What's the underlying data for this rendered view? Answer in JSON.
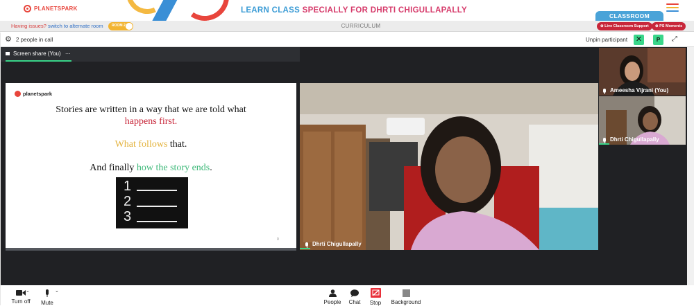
{
  "header": {
    "logo": "PLANETSPARK",
    "tagline_a": "LEARN CLASS",
    "tagline_b": "SPECIALLY FOR DHRTI CHIGULLAPALLY",
    "classroom_tab": "CLASSROOM",
    "menu_colors": [
      "#e8453c",
      "#f2b431",
      "#3a8fd6"
    ]
  },
  "issuebar": {
    "issue_text": "Having issues?",
    "issue_link": "switch to alternate room",
    "room_toggle_label": "ROOM 2",
    "curriculum": "CURRICULUM",
    "support_button": "Live Classroom Support",
    "moments_button": "PS Moments"
  },
  "meet": {
    "people_count": "2 people in call",
    "unpin_label": "Unpin participant",
    "pinned_initial": "P",
    "share_tab": "Screen share (You)",
    "share_more": "···"
  },
  "slide": {
    "logo": "planetspark",
    "line1": "Stories are written in a way that we are told what",
    "line2": "happens first.",
    "line3_highlight": "What follows",
    "line3_rest": " that.",
    "line4_start": "And finally ",
    "line4_highlight": "how the story ends",
    "line4_end": ".",
    "board_numbers": [
      "1",
      "2",
      "3"
    ],
    "page_number": "0"
  },
  "participants": {
    "main": "Dhrti Chigullapally",
    "tile1": "Ameesha Vijrani (You)",
    "tile2": "Dhrti Chigullapally"
  },
  "controls": {
    "camera": "Turn off",
    "mic": "Mute",
    "people": "People",
    "chat": "Chat",
    "stop": "Stop",
    "background": "Background"
  },
  "colors": {
    "accent_green": "#39d68a",
    "brand_red": "#e8453c",
    "brand_blue": "#3a9bd5",
    "brand_pink": "#d63a6a",
    "meet_dark": "#202124"
  }
}
